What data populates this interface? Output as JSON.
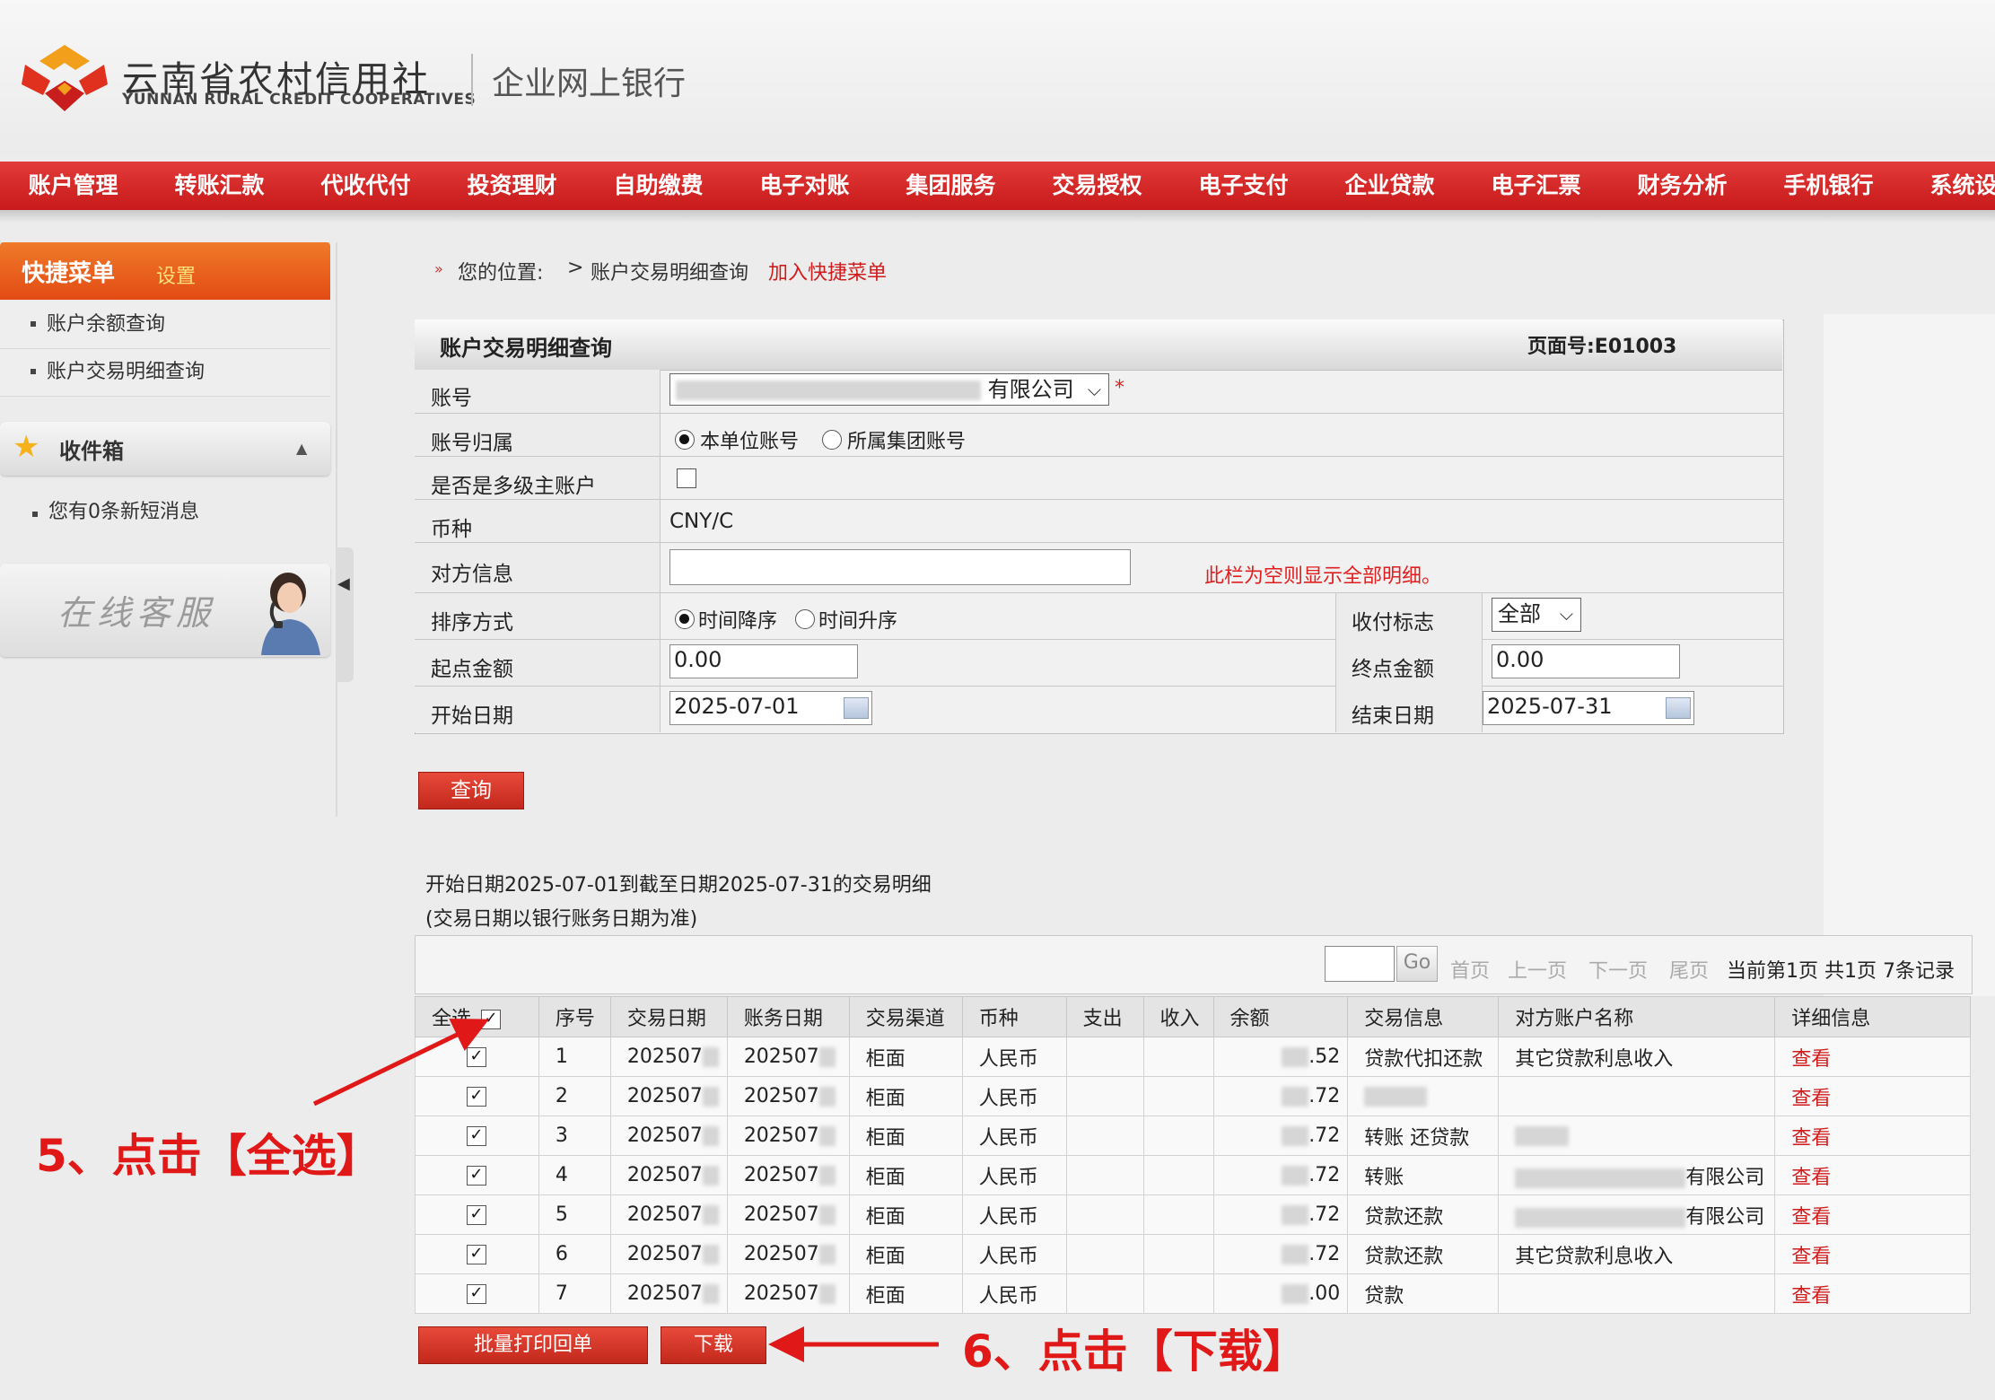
{
  "header": {
    "bank_name_cn": "云南省农村信用社",
    "bank_name_en": "YUNNAN RURAL CREDIT COOPERATIVES",
    "subtitle": "企业网上银行"
  },
  "nav": {
    "items": [
      "账户管理",
      "转账汇款",
      "代收代付",
      "投资理财",
      "自助缴费",
      "电子对账",
      "集团服务",
      "交易授权",
      "电子支付",
      "企业贷款",
      "电子汇票",
      "财务分析",
      "手机银行",
      "系统设置"
    ]
  },
  "sidebar": {
    "quick_menu_title": "快捷菜单",
    "quick_menu_setting": "设置",
    "quick_items": [
      "账户余额查询",
      "账户交易明细查询"
    ],
    "inbox_title": "收件箱",
    "inbox_message": "您有0条新短消息",
    "customer_service": "在线客服"
  },
  "breadcrumb": {
    "label": "您的位置:",
    "sep": ">",
    "page": "账户交易明细查询",
    "add_quick": "加入快捷菜单"
  },
  "form": {
    "title": "账户交易明细查询",
    "page_no": "页面号:E01003",
    "account_label": "账号",
    "account_value": "有限公司",
    "required_mark": "*",
    "ownership_label": "账号归属",
    "ownership_options": [
      "本单位账号",
      "所属集团账号"
    ],
    "multilevel_label": "是否是多级主账户",
    "currency_label": "币种",
    "currency_value": "CNY/C",
    "counterparty_label": "对方信息",
    "counterparty_hint": "此栏为空则显示全部明细。",
    "sort_label": "排序方式",
    "sort_options": [
      "时间降序",
      "时间升序"
    ],
    "flag_label": "收付标志",
    "flag_value": "全部",
    "min_amount_label": "起点金额",
    "min_amount_value": "0.00",
    "max_amount_label": "终点金额",
    "max_amount_value": "0.00",
    "start_date_label": "开始日期",
    "start_date_value": "2025-07-01",
    "end_date_label": "结束日期",
    "end_date_value": "2025-07-31",
    "query_button": "查询"
  },
  "results": {
    "caption_line1": "开始日期2025-07-01到截至日期2025-07-31的交易明细",
    "caption_line2": "(交易日期以银行账务日期为准)",
    "pager": {
      "go": "Go",
      "first": "首页",
      "prev": "上一页",
      "next": "下一页",
      "last": "尾页",
      "info": "当前第1页 共1页 7条记录"
    },
    "columns": [
      "全选",
      "序号",
      "交易日期",
      "账务日期",
      "交易渠道",
      "币种",
      "支出",
      "收入",
      "余额",
      "交易信息",
      "对方账户名称",
      "详细信息"
    ],
    "rows": [
      {
        "no": "1",
        "tx_date": "202507",
        "acct_date": "202507",
        "channel": "柜面",
        "currency": "人民币",
        "balance": ".52",
        "info": "贷款代扣还款",
        "counterparty": "其它贷款利息收入",
        "detail": "查看"
      },
      {
        "no": "2",
        "tx_date": "202507",
        "acct_date": "202507",
        "channel": "柜面",
        "currency": "人民币",
        "balance": ".72",
        "info": "",
        "counterparty": "",
        "detail": "查看"
      },
      {
        "no": "3",
        "tx_date": "202507",
        "acct_date": "202507",
        "channel": "柜面",
        "currency": "人民币",
        "balance": ".72",
        "info": "转账 还贷款",
        "counterparty": "",
        "detail": "查看"
      },
      {
        "no": "4",
        "tx_date": "202507",
        "acct_date": "202507",
        "channel": "柜面",
        "currency": "人民币",
        "balance": ".72",
        "info": "转账",
        "counterparty": "有限公司",
        "detail": "查看"
      },
      {
        "no": "5",
        "tx_date": "202507",
        "acct_date": "202507",
        "channel": "柜面",
        "currency": "人民币",
        "balance": ".72",
        "info": "贷款还款",
        "counterparty": "有限公司",
        "detail": "查看"
      },
      {
        "no": "6",
        "tx_date": "202507",
        "acct_date": "202507",
        "channel": "柜面",
        "currency": "人民币",
        "balance": ".72",
        "info": "贷款还款",
        "counterparty": "其它贷款利息收入",
        "detail": "查看"
      },
      {
        "no": "7",
        "tx_date": "202507",
        "acct_date": "202507",
        "channel": "柜面",
        "currency": "人民币",
        "balance": ".00",
        "info": "贷款",
        "counterparty": "",
        "detail": "查看"
      }
    ],
    "batch_print_button": "批量打印回单",
    "download_button": "下载"
  },
  "annotations": {
    "step5": "5、点击【全选】",
    "step6": "6、点击【下载】"
  },
  "colors": {
    "nav_red": "#d42626",
    "accent_orange": "#e8561c",
    "link_red": "#d01c1c",
    "annotation_red": "#e01818"
  }
}
